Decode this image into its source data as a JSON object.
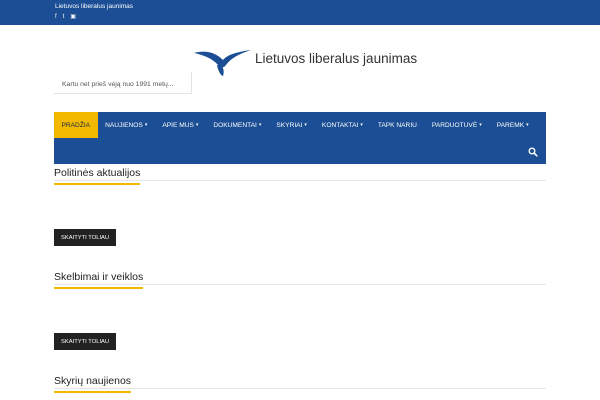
{
  "topbar": {
    "site_name": "Lietuvos liberalus jaunimas",
    "social": [
      {
        "icon": "facebook-icon",
        "glyph": "f"
      },
      {
        "icon": "twitter-icon",
        "glyph": "t"
      },
      {
        "icon": "instagram-icon",
        "glyph": "▣"
      }
    ]
  },
  "header": {
    "logo_text": "Lietuvos liberalus jaunimas",
    "tagline": "Kartu net prieš vėją nuo 1991 metų..."
  },
  "nav": {
    "items": [
      {
        "label": "PRADŽIA",
        "active": true,
        "dropdown": false
      },
      {
        "label": "NAUJIENOS",
        "active": false,
        "dropdown": true
      },
      {
        "label": "APIE MUS",
        "active": false,
        "dropdown": true
      },
      {
        "label": "DOKUMENTAI",
        "active": false,
        "dropdown": true
      },
      {
        "label": "SKYRIAI",
        "active": false,
        "dropdown": true
      },
      {
        "label": "KONTAKTAI",
        "active": false,
        "dropdown": true
      },
      {
        "label": "TAPK NARIU",
        "active": false,
        "dropdown": false
      },
      {
        "label": "PARDUOTUVĖ",
        "active": false,
        "dropdown": true
      },
      {
        "label": "PAREMK",
        "active": false,
        "dropdown": true
      }
    ],
    "search_icon": "search-icon"
  },
  "sections": [
    {
      "title": "Politinės aktualijos",
      "button": "SKAITYTI TOLIAU"
    },
    {
      "title": "Skelbimai ir veiklos",
      "button": "SKAITYTI TOLIAU"
    },
    {
      "title": "Skyrių naujienos"
    }
  ],
  "colors": {
    "brand_blue": "#1b4e94",
    "accent_yellow": "#f2b900",
    "button_dark": "#222222"
  }
}
